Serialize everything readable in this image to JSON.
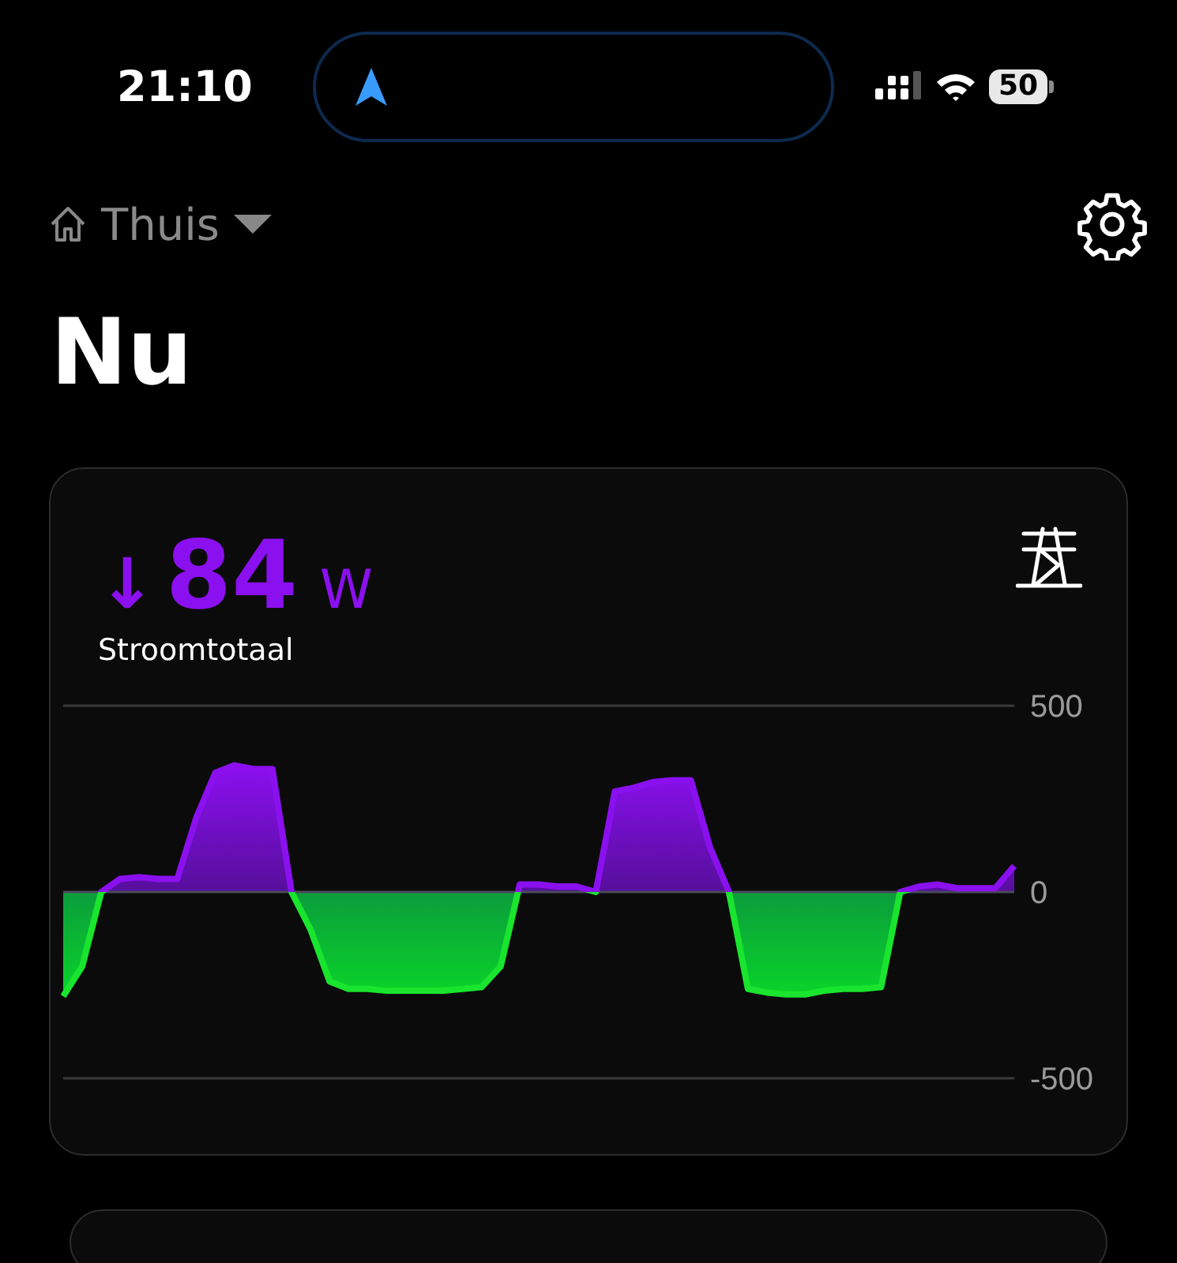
{
  "status_bar": {
    "time": "21:10",
    "battery": "50"
  },
  "header": {
    "location": "Thuis"
  },
  "title": "Nu",
  "power_card": {
    "arrow": "↓",
    "value": "84",
    "unit": "W",
    "label": "Stroomtotaal",
    "chart_data": {
      "type": "area",
      "yticks": [
        500,
        0,
        -500
      ],
      "ylim": [
        -500,
        500
      ],
      "series": [
        {
          "color": "#8b10f0",
          "values": [
            -280,
            -200,
            0,
            35,
            40,
            35,
            35,
            200,
            320,
            340,
            330,
            330,
            0,
            -100,
            -240,
            -260,
            -260,
            -265,
            -265,
            -265,
            -265,
            -260,
            -255,
            -200,
            20,
            20,
            15,
            15,
            0,
            270,
            280,
            295,
            300,
            300,
            120,
            0,
            -260,
            -270,
            -275,
            -275,
            -265,
            -260,
            -260,
            -255,
            0,
            15,
            20,
            10,
            10,
            10,
            70
          ]
        }
      ]
    }
  }
}
